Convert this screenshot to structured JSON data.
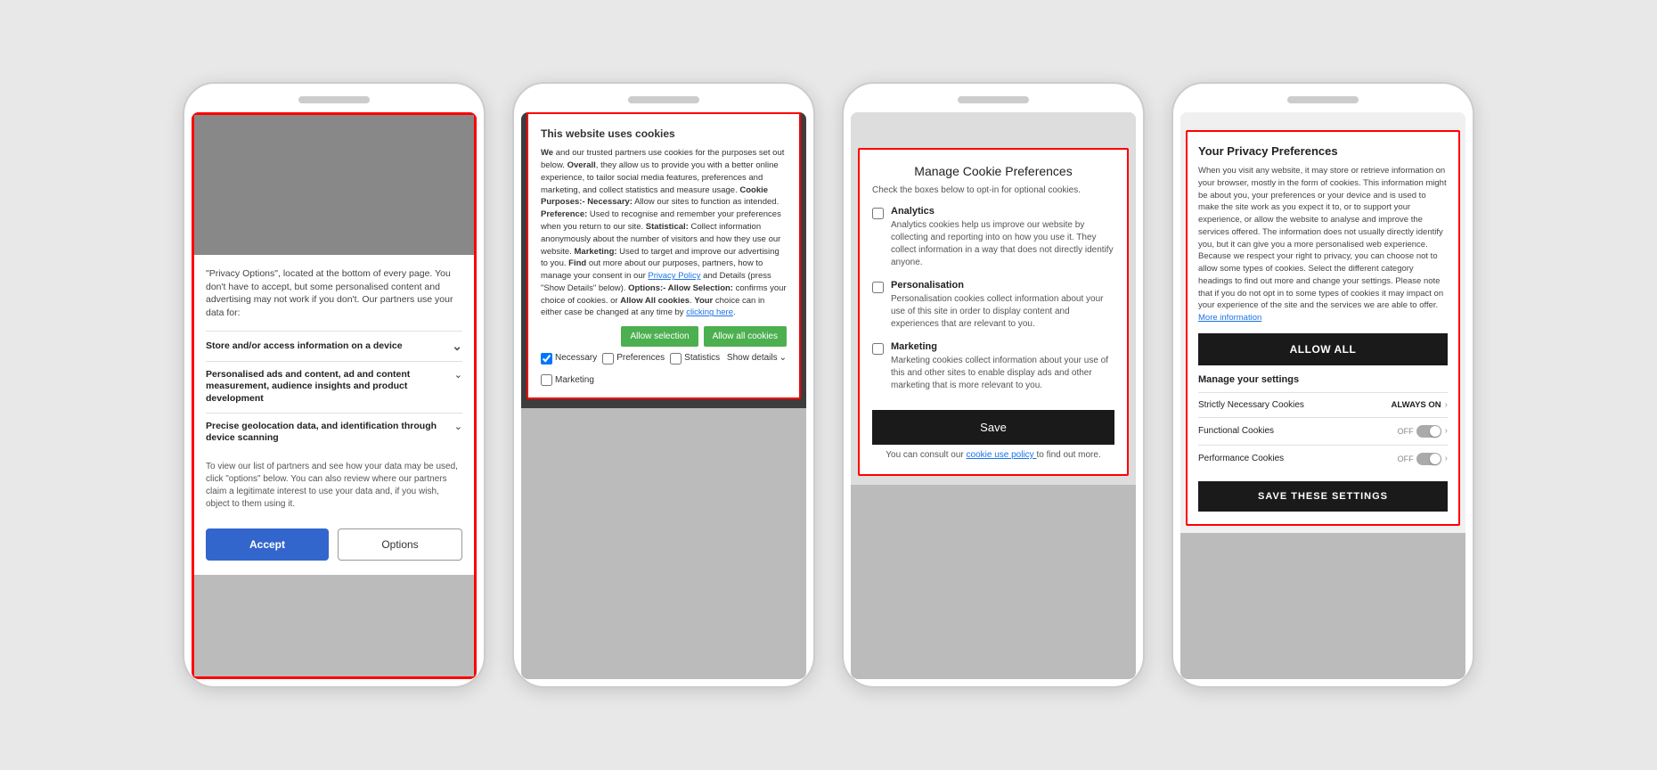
{
  "phone1": {
    "intro_text": "\"Privacy Options\", located at the bottom of every page. You don't have to accept, but some personalised content and advertising may not work if you don't. Our partners use your data for:",
    "items": [
      {
        "label": "Store and/or access information on a device",
        "multiline": false
      },
      {
        "label": "Personalised ads and content, ad and content measurement, audience insights and product development",
        "multiline": true
      },
      {
        "label": "Precise geolocation data, and identification through device scanning",
        "multiline": true
      }
    ],
    "partners_text": "To view our list of partners and see how your data may be used, click \"options\" below. You can also review where our partners claim a legitimate interest to use your data and, if you wish, object to them using it.",
    "accept_label": "Accept",
    "options_label": "Options"
  },
  "phone2": {
    "title": "This website uses cookies",
    "body": "We and our trusted partners use cookies for the purposes set out below. Overall, they allow us to provide you with a better online experience, to tailor social media features, preferences and marketing, and collect statistics and measure usage. Cookie Purposes:- Necessary: Allow our sites to function as intended. Preference: Used to recognise and remember your preferences when you return to our site. Statistical: Collect information anonymously about the number of visitors and how they use our website. Marketing: Used to target and improve our advertising to you. Find out more about our purposes, partners, how to manage your consent in our Privacy Policy and Details (press \"Show Details\" below). Options:- Allow Selection: confirms your choice of cookies. or Allow All cookies. Your choice can in either case be changed at any time by clicking here.",
    "privacy_policy_link": "Privacy Policy",
    "clicking_here_link": "clicking here",
    "btn_allow_selection": "Allow selection",
    "btn_allow_all": "Allow all cookies",
    "checkboxes": [
      {
        "label": "Necessary",
        "checked": true
      },
      {
        "label": "Preferences",
        "checked": false
      },
      {
        "label": "Statistics",
        "checked": false
      },
      {
        "label": "Marketing",
        "checked": false
      }
    ],
    "show_details_label": "Show details"
  },
  "phone3": {
    "title": "Manage Cookie Preferences",
    "subtitle": "Check the boxes below to opt-in for optional cookies.",
    "items": [
      {
        "label": "Analytics",
        "description": "Analytics cookies help us improve our website by collecting and reporting into on how you use it. They collect information in a way that does not directly identify anyone.",
        "checked": false
      },
      {
        "label": "Personalisation",
        "description": "Personalisation cookies collect information about your use of this site in order to display content and experiences that are relevant to you.",
        "checked": false
      },
      {
        "label": "Marketing",
        "description": "Marketing cookies collect information about your use of this and other sites to enable display ads and other marketing that is more relevant to you.",
        "checked": false
      }
    ],
    "save_label": "Save",
    "consult_text": "You can consult our",
    "cookie_link": "cookie use policy",
    "consult_text2": "to find out more."
  },
  "phone4": {
    "title": "Your Privacy Preferences",
    "description": "When you visit any website, it may store or retrieve information on your browser, mostly in the form of cookies. This information might be about you, your preferences or your device and is used to make the site work as you expect it to, or to support your experience, or allow the website to analyse and improve the services offered. The information does not usually directly identify you, but it can give you a more personalised web experience. Because we respect your right to privacy, you can choose not to allow some types of cookies. Select the different category headings to find out more and change your settings. Please note that if you do not opt in to some types of cookies it may impact on your experience of the site and the services we are able to offer.",
    "more_info_link": "More information",
    "allow_all_label": "ALLOW ALL",
    "manage_settings_title": "Manage your settings",
    "settings_rows": [
      {
        "label": "Strictly Necessary Cookies",
        "status": "ALWAYS ON",
        "type": "always_on"
      },
      {
        "label": "Functional Cookies",
        "status": "OFF",
        "type": "toggle"
      },
      {
        "label": "Performance Cookies",
        "status": "OFF",
        "type": "toggle"
      }
    ],
    "save_settings_label": "SAVE THESE SETTINGS"
  }
}
